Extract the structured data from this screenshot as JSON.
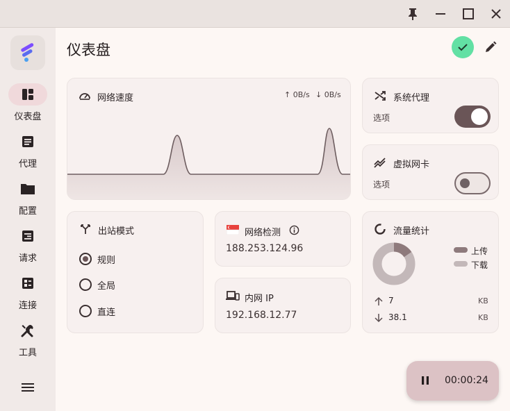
{
  "window": {
    "controls": [
      "pin-icon",
      "minimize-icon",
      "maximize-icon",
      "close-icon"
    ]
  },
  "sidebar": {
    "items": [
      {
        "label": "仪表盘",
        "icon": "dashboard-icon",
        "active": true
      },
      {
        "label": "代理",
        "icon": "proxy-list-icon",
        "active": false
      },
      {
        "label": "配置",
        "icon": "folder-icon",
        "active": false
      },
      {
        "label": "请求",
        "icon": "request-icon",
        "active": false
      },
      {
        "label": "连接",
        "icon": "connections-icon",
        "active": false
      },
      {
        "label": "工具",
        "icon": "tools-icon",
        "active": false
      }
    ],
    "menu_icon": "menu-icon"
  },
  "header": {
    "title": "仪表盘"
  },
  "network_speed": {
    "title": "网络速度",
    "upload": "↑ 0B/s",
    "download": "↓ 0B/s"
  },
  "system_proxy": {
    "title": "系统代理",
    "subtitle": "选项",
    "enabled": true
  },
  "virtual_nic": {
    "title": "虚拟网卡",
    "subtitle": "选项",
    "enabled": false
  },
  "outbound_mode": {
    "title": "出站模式",
    "options": [
      "规则",
      "全局",
      "直连"
    ],
    "selected": 0
  },
  "network_check": {
    "title": "网络检测",
    "value": "188.253.124.96"
  },
  "intranet_ip": {
    "title": "内网 IP",
    "value": "192.168.12.77"
  },
  "traffic": {
    "title": "流量统计",
    "legend": [
      {
        "label": "上传",
        "color": "#8e7a7c"
      },
      {
        "label": "下载",
        "color": "#c3b8b9"
      }
    ],
    "upload_value": "7",
    "download_value": "38.1",
    "upload_unit": "KB",
    "download_unit": "KB",
    "upload_share": 0.155
  },
  "timer": {
    "time": "00:00:24"
  },
  "colors": {
    "accent": "#6a5557",
    "success": "#62e0a4",
    "nav_active": "#f0d9db"
  }
}
